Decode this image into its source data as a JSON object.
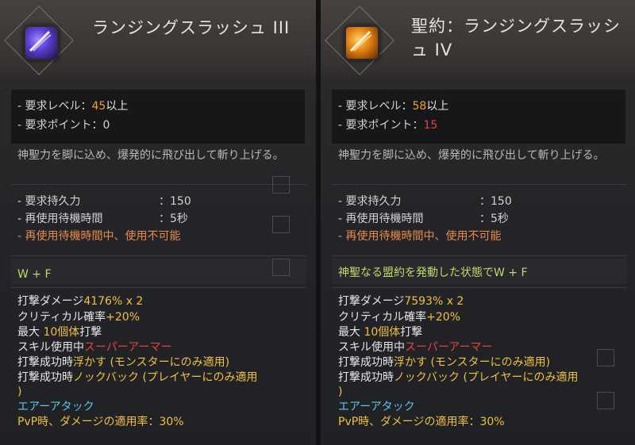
{
  "left": {
    "title": "ランジングスラッシュ III",
    "req_level_label": "- 要求レベル：",
    "req_level_value": "45",
    "req_level_suffix": "以上",
    "req_point_label": "- 要求ポイント：",
    "req_point_value": "0",
    "description": "神聖力を脚に込め、爆発的に飛び出して斬り上げる。",
    "stamina_label": "- 要求持久力",
    "stamina_value": "：150",
    "cooldown_label": "- 再使用待機時間",
    "cooldown_value": "：5秒",
    "cooldown_warning": "- 再使用待機時間中、使用不可能",
    "command": "W + F",
    "damage_label": "打撃ダメージ",
    "damage_value": "4176% x 2",
    "crit_label": "クリティカル確率",
    "crit_value": "+20%",
    "max_label": "最大 ",
    "max_value": "10個体",
    "max_suffix": "打撃",
    "skill_use_label": "スキル使用中",
    "skill_use_value": "スーパーアーマー",
    "float_label": "打撃成功時",
    "float_value": "浮かす",
    "float_note": " (モンスターにのみ適用)",
    "knock_label": "打撃成功時",
    "knock_value": "ノックバック",
    "knock_note": " (プレイヤーにのみ適用",
    "knock_close": ")",
    "air_attack": "エアーアタック",
    "pvp": "PvP時、ダメージの適用率：30%"
  },
  "right": {
    "title": "聖約：ランジングスラッシュ IV",
    "req_level_label": "- 要求レベル：",
    "req_level_value": "58",
    "req_level_suffix": "以上",
    "req_point_label": "- 要求ポイント：",
    "req_point_value": "15",
    "description": "神聖力を脚に込め、爆発的に飛び出して斬り上げる。",
    "stamina_label": "- 要求持久力",
    "stamina_value": "：150",
    "cooldown_label": "- 再使用待機時間",
    "cooldown_value": "：5秒",
    "cooldown_warning": "- 再使用待機時間中、使用不可能",
    "command_prefix": "神聖なる盟約を発動した状態で",
    "command": "W + F",
    "damage_label": "打撃ダメージ",
    "damage_value": "7593% x 2",
    "crit_label": "クリティカル確率",
    "crit_value": "+20%",
    "max_label": "最大 ",
    "max_value": "10個体",
    "max_suffix": "打撃",
    "skill_use_label": "スキル使用中",
    "skill_use_value": "スーパーアーマー",
    "float_label": "打撃成功時",
    "float_value": "浮かす",
    "float_note": " (モンスターにのみ適用)",
    "knock_label": "打撃成功時",
    "knock_value": "ノックバック",
    "knock_note": " (プレイヤーにのみ適用",
    "knock_close": ")",
    "air_attack": "エアーアタック",
    "pvp": "PvP時、ダメージの適用率：30%"
  },
  "colors": {
    "highlight_orange": "#f0a030",
    "highlight_red": "#e0443a",
    "warning": "#e88a4a",
    "command_green": "#c3d86a",
    "air_blue": "#5cc4ea"
  },
  "icons": {
    "left_skill": "purple-slash-icon",
    "right_skill": "orange-slash-icon"
  }
}
